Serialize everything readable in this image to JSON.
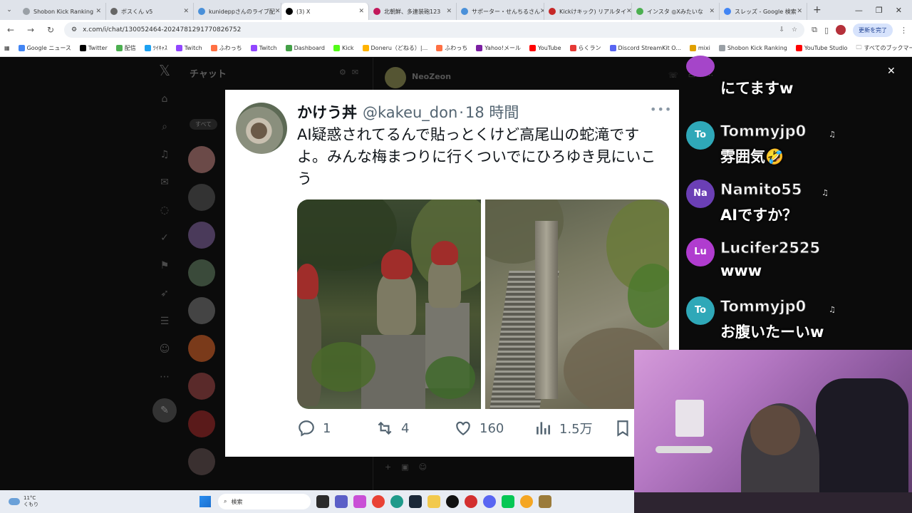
{
  "browser": {
    "tabs": [
      {
        "title": "Shobon Kick Ranking",
        "color": "#9aa0a6"
      },
      {
        "title": "ボスくん v5",
        "color": "#666666"
      },
      {
        "title": "kunideppさんのライブ配",
        "color": "#4a90d9"
      },
      {
        "title": "(3) X",
        "color": "#000000",
        "active": true
      },
      {
        "title": "北朝鮮、多連装砲123",
        "color": "#c2185b"
      },
      {
        "title": "サポーター・せんちるさん",
        "color": "#4a90d9"
      },
      {
        "title": "Kickけキック) リアルタイ",
        "color": "#c62828"
      },
      {
        "title": "インスタ ◎Xみたいな",
        "color": "#4caf50"
      },
      {
        "title": "スレッズ - Google 検索",
        "color": "#4285f4"
      }
    ],
    "new_tab": "+",
    "url": "x.com/i/chat/130052464-2024781291770826752",
    "update_label": "更新を完了",
    "bookmarks": [
      {
        "label": "Google ニュース",
        "color": "#4285f4"
      },
      {
        "label": "Twitter",
        "color": "#000000"
      },
      {
        "label": "配信",
        "color": "#4caf50"
      },
      {
        "label": "ﾂｲｷｬｽ",
        "color": "#1da1f2"
      },
      {
        "label": "Twitch",
        "color": "#9146ff"
      },
      {
        "label": "ふわっち",
        "color": "#ff7043"
      },
      {
        "label": "Twitch",
        "color": "#9146ff"
      },
      {
        "label": "Dashboard",
        "color": "#43a047"
      },
      {
        "label": "Kick",
        "color": "#53fc18"
      },
      {
        "label": "Doneru（どねる）|...",
        "color": "#ffb300"
      },
      {
        "label": "ふわっち",
        "color": "#ff7043"
      },
      {
        "label": "Yahoo!メール",
        "color": "#7b1fa2"
      },
      {
        "label": "YouTube",
        "color": "#ff0000"
      },
      {
        "label": "らくラン",
        "color": "#e53935"
      },
      {
        "label": "Discord StreamKit O...",
        "color": "#5865f2"
      },
      {
        "label": "mixi",
        "color": "#e0a000"
      },
      {
        "label": "Shobon Kick Ranking",
        "color": "#9aa0a6"
      },
      {
        "label": "YouTube Studio",
        "color": "#ff0000"
      }
    ],
    "all_bookmarks": "すべてのブックマーク"
  },
  "x": {
    "chat_title": "チャット",
    "filter_all": "すべて",
    "convo_name": "NeoZeon"
  },
  "tweet": {
    "name": "かけう丼",
    "handle": "@kakeu_don",
    "dot": "·",
    "time": "18 時間",
    "more": "•••",
    "text": "AI疑惑されてるんで貼っとくけど高尾山の蛇滝ですよ。みんな梅まつりに行くついでにひろゆき見にいこう",
    "replies": "1",
    "retweets": "4",
    "likes": "160",
    "views": "1.5万"
  },
  "chat": [
    {
      "initials": "",
      "user": "",
      "text": "にてますw",
      "color": "#a545c9"
    },
    {
      "initials": "To",
      "user": "Tommyjp0",
      "text": "雰囲気🤣",
      "color": "#2fa8b8"
    },
    {
      "initials": "Na",
      "user": "Namito55",
      "text": "AIですか？",
      "color": "#6b3fb5"
    },
    {
      "initials": "Lu",
      "user": "Lucifer2525",
      "text": "www",
      "color": "#b03ccf"
    },
    {
      "initials": "To",
      "user": "Tommyjp0",
      "text": "お腹いたーいw",
      "color": "#2fa8b8"
    }
  ],
  "taskbar": {
    "temp": "11°C",
    "weather": "くもり",
    "search_placeholder": "検索"
  }
}
